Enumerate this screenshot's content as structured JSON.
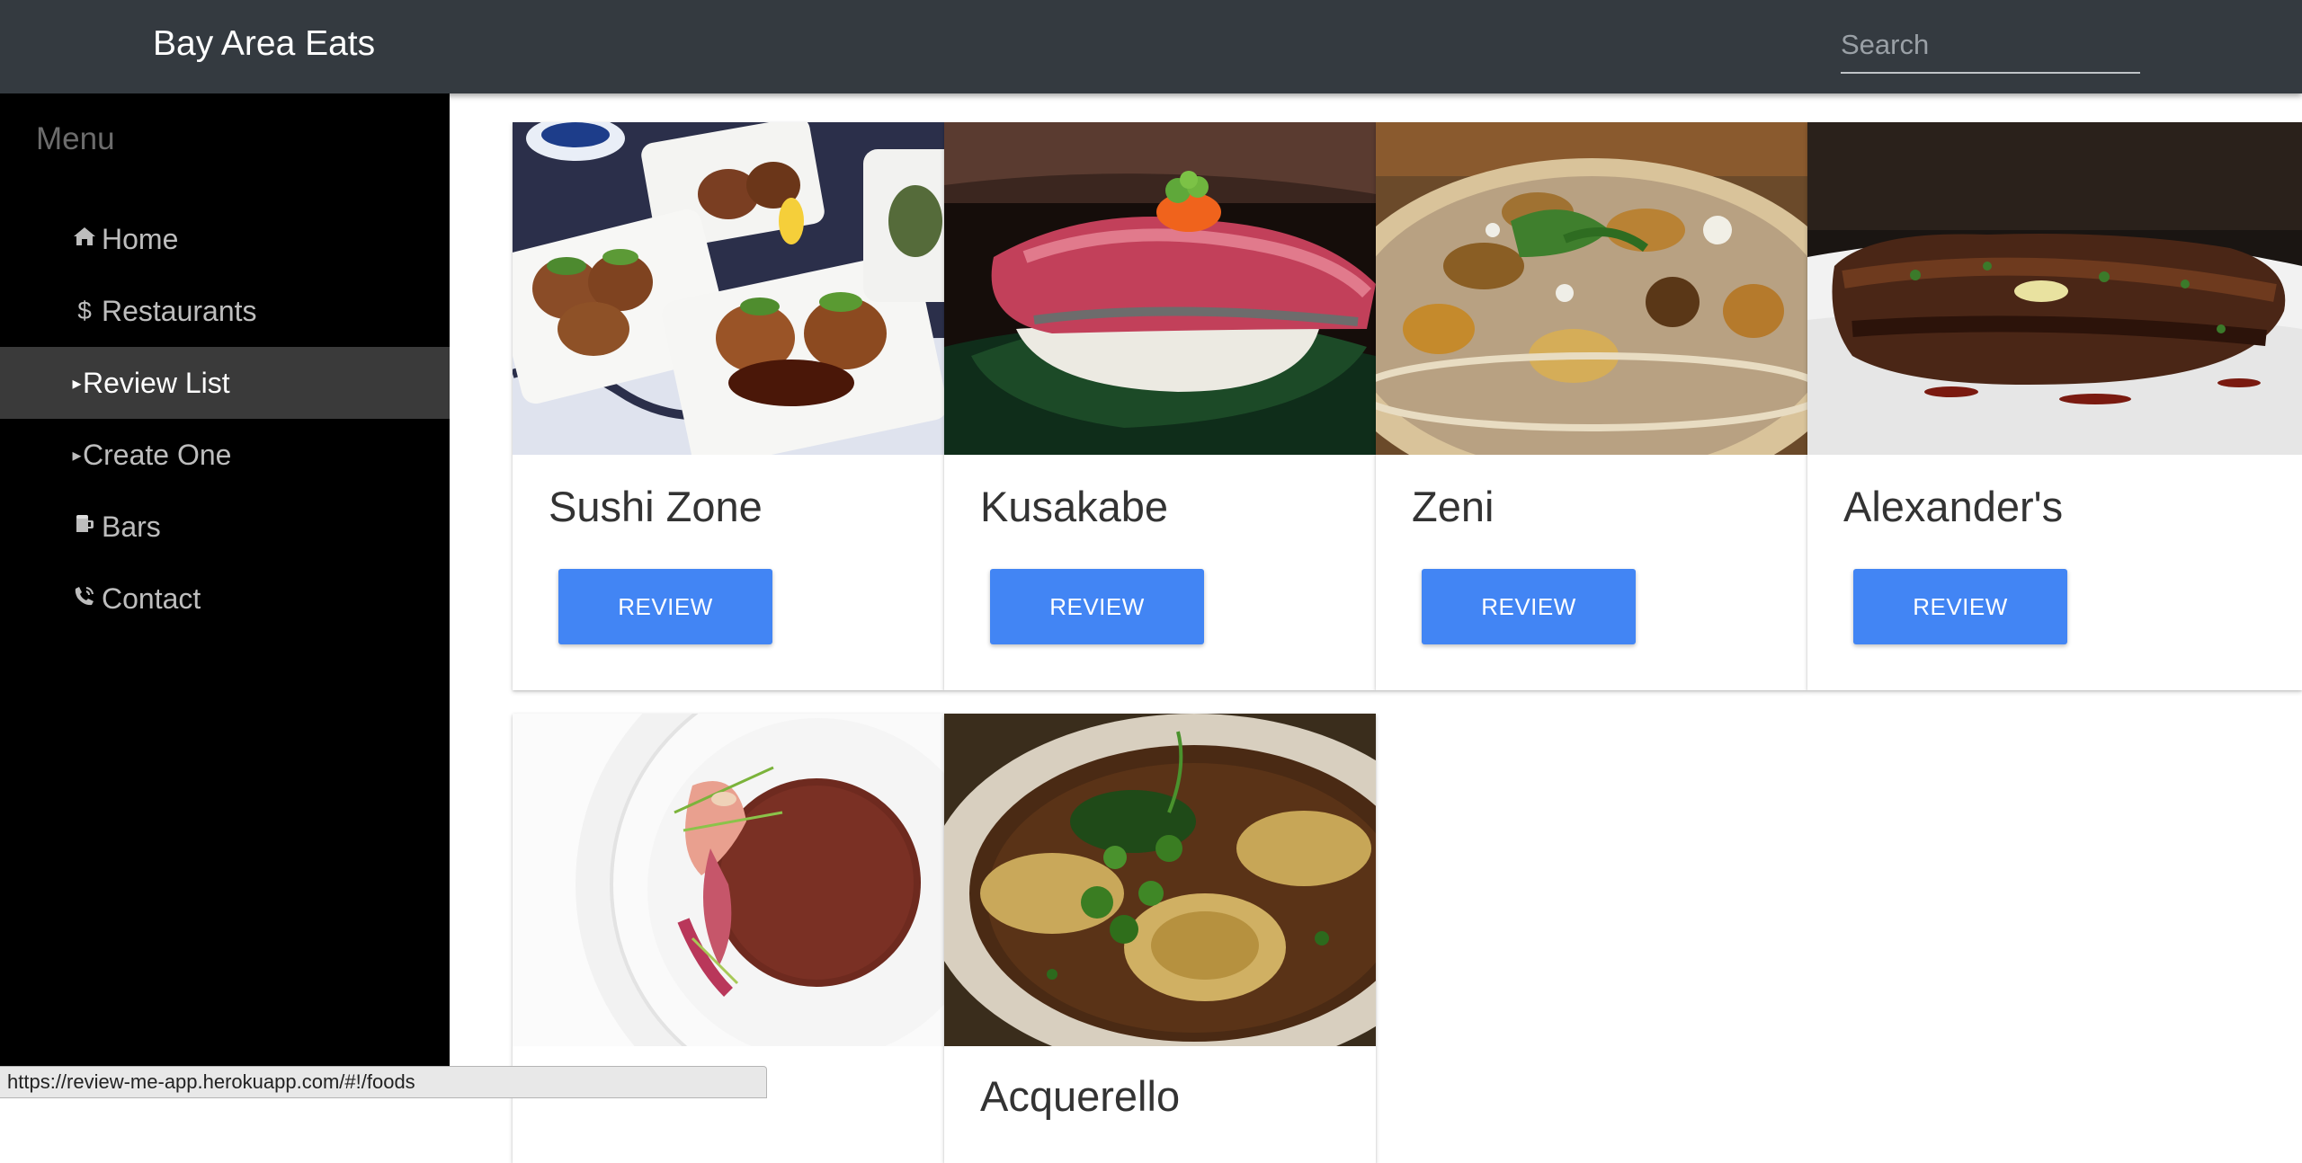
{
  "app": {
    "brand": "Bay Area Eats"
  },
  "search": {
    "placeholder": "Search",
    "value": ""
  },
  "sidebar": {
    "heading": "Menu",
    "items": [
      {
        "label": "Home",
        "icon": "home-icon",
        "active": false
      },
      {
        "label": "Restaurants",
        "icon": "dollar-icon",
        "active": false
      },
      {
        "label": "Review List",
        "icon": "caret-right-icon",
        "active": true
      },
      {
        "label": "Create One",
        "icon": "caret-right-icon",
        "active": false
      },
      {
        "label": "Bars",
        "icon": "beer-icon",
        "active": false
      },
      {
        "label": "Contact",
        "icon": "phone-icon",
        "active": false
      }
    ]
  },
  "cards": [
    {
      "title": "Sushi Zone",
      "button": "REVIEW",
      "image": "sushi-plate-photo"
    },
    {
      "title": "Kusakabe",
      "button": "REVIEW",
      "image": "nigiri-photo"
    },
    {
      "title": "Zeni",
      "button": "REVIEW",
      "image": "injera-platter-photo"
    },
    {
      "title": "Alexander's",
      "button": "REVIEW",
      "image": "steak-photo"
    },
    {
      "title": "",
      "button": "",
      "image": "soup-plate-photo"
    },
    {
      "title": "Acquerello",
      "button": "",
      "image": "ravioli-photo"
    }
  ],
  "statusbar": {
    "url": "https://review-me-app.herokuapp.com/#!/foods"
  },
  "colors": {
    "navbar": "#343a40",
    "sidebar": "#000000",
    "active_item": "#3a3a3a",
    "button": "#4285f4"
  }
}
